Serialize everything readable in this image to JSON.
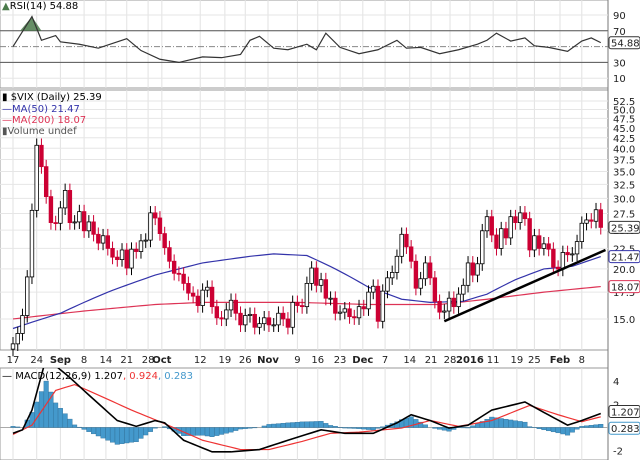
{
  "rsi_legend": "RSI(14) 54.88",
  "price_legend": {
    "title": "$VIX (Daily) 25.39",
    "ma50": "MA(50) 21.47",
    "ma200": "MA(200) 18.07",
    "volume": "Volume undef"
  },
  "macd_legend": {
    "label": "MACD(12,26,9) 1.207",
    "signal": ", 0.924",
    "hist": ", 0.283"
  },
  "colors": {
    "up": "#000000",
    "down": "#cc0033",
    "ma50": "#3333aa",
    "ma200": "#dd3355",
    "macd": "#000000",
    "signal": "#ee3333",
    "hist": "#4499cc",
    "rsi_fill": "#4a7a4a"
  },
  "chart_data": [
    {
      "type": "line",
      "title": "RSI(14)",
      "ylim": [
        0,
        100
      ],
      "ticks": [
        "90",
        "70",
        "30",
        "10"
      ],
      "levels": [
        70,
        50,
        30
      ],
      "last_label": "54.88",
      "points": [
        [
          0,
          50
        ],
        [
          4,
          88
        ],
        [
          6,
          58
        ],
        [
          9,
          64
        ],
        [
          10,
          56
        ],
        [
          14,
          53
        ],
        [
          18,
          48
        ],
        [
          24,
          60
        ],
        [
          27,
          45
        ],
        [
          31,
          34
        ],
        [
          35,
          30
        ],
        [
          40,
          37
        ],
        [
          44,
          36
        ],
        [
          48,
          40
        ],
        [
          50,
          58
        ],
        [
          52,
          63
        ],
        [
          55,
          48
        ],
        [
          58,
          46
        ],
        [
          62,
          53
        ],
        [
          64,
          46
        ],
        [
          66,
          67
        ],
        [
          69,
          49
        ],
        [
          73,
          41
        ],
        [
          77,
          46
        ],
        [
          81,
          58
        ],
        [
          83,
          48
        ],
        [
          86,
          49
        ],
        [
          90,
          41
        ],
        [
          94,
          46
        ],
        [
          98,
          53
        ],
        [
          100,
          58
        ],
        [
          102,
          67
        ],
        [
          105,
          57
        ],
        [
          108,
          61
        ],
        [
          110,
          51
        ],
        [
          113,
          49
        ],
        [
          117,
          44
        ],
        [
          120,
          57
        ],
        [
          122,
          61
        ],
        [
          124,
          55
        ]
      ]
    },
    {
      "type": "candlestick",
      "title": "$VIX (Daily)",
      "scale": "log",
      "ylim": [
        12.5,
        55
      ],
      "ticks": [
        "52.5",
        "50.0",
        "47.5",
        "45.0",
        "42.5",
        "40.0",
        "37.5",
        "35.0",
        "32.5",
        "30.0",
        "27.5",
        "25.0",
        "22.5",
        "20.0",
        "17.5",
        "15.0"
      ],
      "close": [
        13.0,
        13.8,
        15.3,
        19.1,
        28.0,
        40.7,
        36.0,
        30.3,
        26.1,
        26.0,
        28.4,
        31.4,
        26.1,
        26.2,
        27.8,
        24.9,
        26.2,
        24.4,
        23.2,
        24.2,
        22.5,
        21.4,
        21.1,
        22.3,
        20.1,
        22.4,
        22.1,
        23.5,
        23.6,
        27.6,
        26.8,
        24.5,
        22.6,
        20.9,
        19.5,
        19.4,
        18.4,
        17.4,
        17.1,
        16.2,
        17.7,
        18.0,
        16.1,
        15.1,
        15.0,
        15.8,
        16.7,
        15.5,
        14.5,
        15.3,
        15.4,
        14.3,
        14.6,
        15.1,
        14.5,
        14.5,
        15.5,
        15.0,
        14.3,
        16.5,
        16.2,
        16.1,
        18.4,
        20.1,
        18.2,
        18.8,
        16.9,
        16.9,
        15.5,
        15.6,
        15.9,
        15.2,
        15.1,
        16.1,
        15.9,
        17.5,
        18.1,
        14.8,
        17.6,
        19.0,
        19.6,
        21.5,
        24.4,
        22.7,
        20.9,
        17.9,
        18.9,
        20.7,
        19.0,
        16.6,
        15.6,
        15.7,
        16.9,
        16.1,
        17.3,
        18.2,
        20.7,
        19.3,
        20.6,
        24.9,
        27.0,
        24.3,
        22.5,
        25.2,
        23.9,
        27.0,
        26.1,
        27.6,
        26.7,
        22.3,
        24.2,
        22.5,
        23.1,
        22.4,
        20.2,
        19.98,
        21.98,
        21.7,
        21.8,
        23.4,
        26.0,
        26.5,
        26.3,
        28.1,
        25.39
      ],
      "ma50": [
        [
          0,
          14.2
        ],
        [
          10,
          15.5
        ],
        [
          20,
          17.5
        ],
        [
          30,
          19.3
        ],
        [
          40,
          20.7
        ],
        [
          50,
          21.5
        ],
        [
          55,
          21.8
        ],
        [
          62,
          21.6
        ],
        [
          68,
          20.0
        ],
        [
          75,
          18.0
        ],
        [
          82,
          16.8
        ],
        [
          88,
          16.5
        ],
        [
          95,
          16.6
        ],
        [
          100,
          17.3
        ],
        [
          106,
          18.8
        ],
        [
          112,
          20.0
        ],
        [
          118,
          20.3
        ],
        [
          124,
          21.47
        ]
      ],
      "ma200": [
        [
          0,
          15.0
        ],
        [
          15,
          15.7
        ],
        [
          30,
          16.3
        ],
        [
          40,
          16.5
        ],
        [
          60,
          16.5
        ],
        [
          75,
          16.3
        ],
        [
          90,
          16.3
        ],
        [
          100,
          16.8
        ],
        [
          112,
          17.5
        ],
        [
          124,
          18.07
        ]
      ],
      "trendline": [
        [
          91,
          14.8
        ],
        [
          125,
          22.3
        ]
      ],
      "last_labels": {
        "close": "25.39",
        "ma50": "21.47",
        "ma200": "18.07"
      }
    },
    {
      "type": "line",
      "title": "MACD(12,26,9)",
      "ylim": [
        -2.8,
        5.0
      ],
      "ticks": [
        "4",
        "2",
        "-2"
      ],
      "last_labels": {
        "macd": "1.207",
        "hist": "0.283"
      },
      "macd": [
        [
          0,
          -0.5
        ],
        [
          2,
          -0.2
        ],
        [
          4,
          1.5
        ],
        [
          6,
          4.5
        ],
        [
          7,
          6.0
        ],
        [
          12,
          4.3
        ],
        [
          16,
          2.8
        ],
        [
          22,
          0.6
        ],
        [
          26,
          0.1
        ],
        [
          30,
          0.6
        ],
        [
          32,
          0.4
        ],
        [
          36,
          -1.1
        ],
        [
          42,
          -2.1
        ],
        [
          46,
          -2.1
        ],
        [
          52,
          -1.9
        ],
        [
          58,
          -1.1
        ],
        [
          65,
          -0.2
        ],
        [
          70,
          -0.5
        ],
        [
          76,
          -0.5
        ],
        [
          81,
          0.4
        ],
        [
          84,
          1.1
        ],
        [
          88,
          0.6
        ],
        [
          92,
          -0.05
        ],
        [
          96,
          0.2
        ],
        [
          101,
          1.5
        ],
        [
          105,
          1.9
        ],
        [
          108,
          2.2
        ],
        [
          112,
          1.3
        ],
        [
          117,
          0.2
        ],
        [
          120,
          0.6
        ],
        [
          124,
          1.207
        ]
      ],
      "signal": [
        [
          0,
          -0.6
        ],
        [
          4,
          0.2
        ],
        [
          9,
          3.2
        ],
        [
          13,
          3.7
        ],
        [
          18,
          2.8
        ],
        [
          25,
          1.5
        ],
        [
          31,
          0.5
        ],
        [
          40,
          -1.1
        ],
        [
          48,
          -1.9
        ],
        [
          54,
          -1.9
        ],
        [
          61,
          -1.2
        ],
        [
          67,
          -0.5
        ],
        [
          73,
          -0.4
        ],
        [
          82,
          -0.05
        ],
        [
          88,
          0.6
        ],
        [
          94,
          0.1
        ],
        [
          101,
          0.6
        ],
        [
          109,
          1.9
        ],
        [
          115,
          1.1
        ],
        [
          120,
          0.5
        ],
        [
          124,
          0.924
        ]
      ]
    },
    {
      "type": "axis",
      "dates": [
        {
          "t": "17",
          "i": 0
        },
        {
          "t": "24",
          "i": 5
        },
        {
          "t": "Sep",
          "i": 10,
          "b": 1
        },
        {
          "t": "8",
          "i": 15
        },
        {
          "t": "14",
          "i": 19.6
        },
        {
          "t": "21",
          "i": 24
        },
        {
          "t": "28",
          "i": 28.5
        },
        {
          "t": "Oct",
          "i": 31.4,
          "b": 1
        },
        {
          "t": "12",
          "i": 39.5
        },
        {
          "t": "19",
          "i": 44.7
        },
        {
          "t": "26",
          "i": 49
        },
        {
          "t": "Nov",
          "i": 53.8,
          "b": 1
        },
        {
          "t": "9",
          "i": 60
        },
        {
          "t": "16",
          "i": 64.3
        },
        {
          "t": "23",
          "i": 69
        },
        {
          "t": "Dec",
          "i": 73.8,
          "b": 1
        },
        {
          "t": "7",
          "i": 78.5
        },
        {
          "t": "14",
          "i": 83.7
        },
        {
          "t": "21",
          "i": 88.2
        },
        {
          "t": "28",
          "i": 92.2
        },
        {
          "t": "2016",
          "i": 96.4,
          "b": 1
        },
        {
          "t": "11",
          "i": 101.3
        },
        {
          "t": "19",
          "i": 106.3
        },
        {
          "t": "25",
          "i": 110
        },
        {
          "t": "Feb",
          "i": 115.4,
          "b": 1
        },
        {
          "t": "8",
          "i": 120
        }
      ]
    }
  ]
}
